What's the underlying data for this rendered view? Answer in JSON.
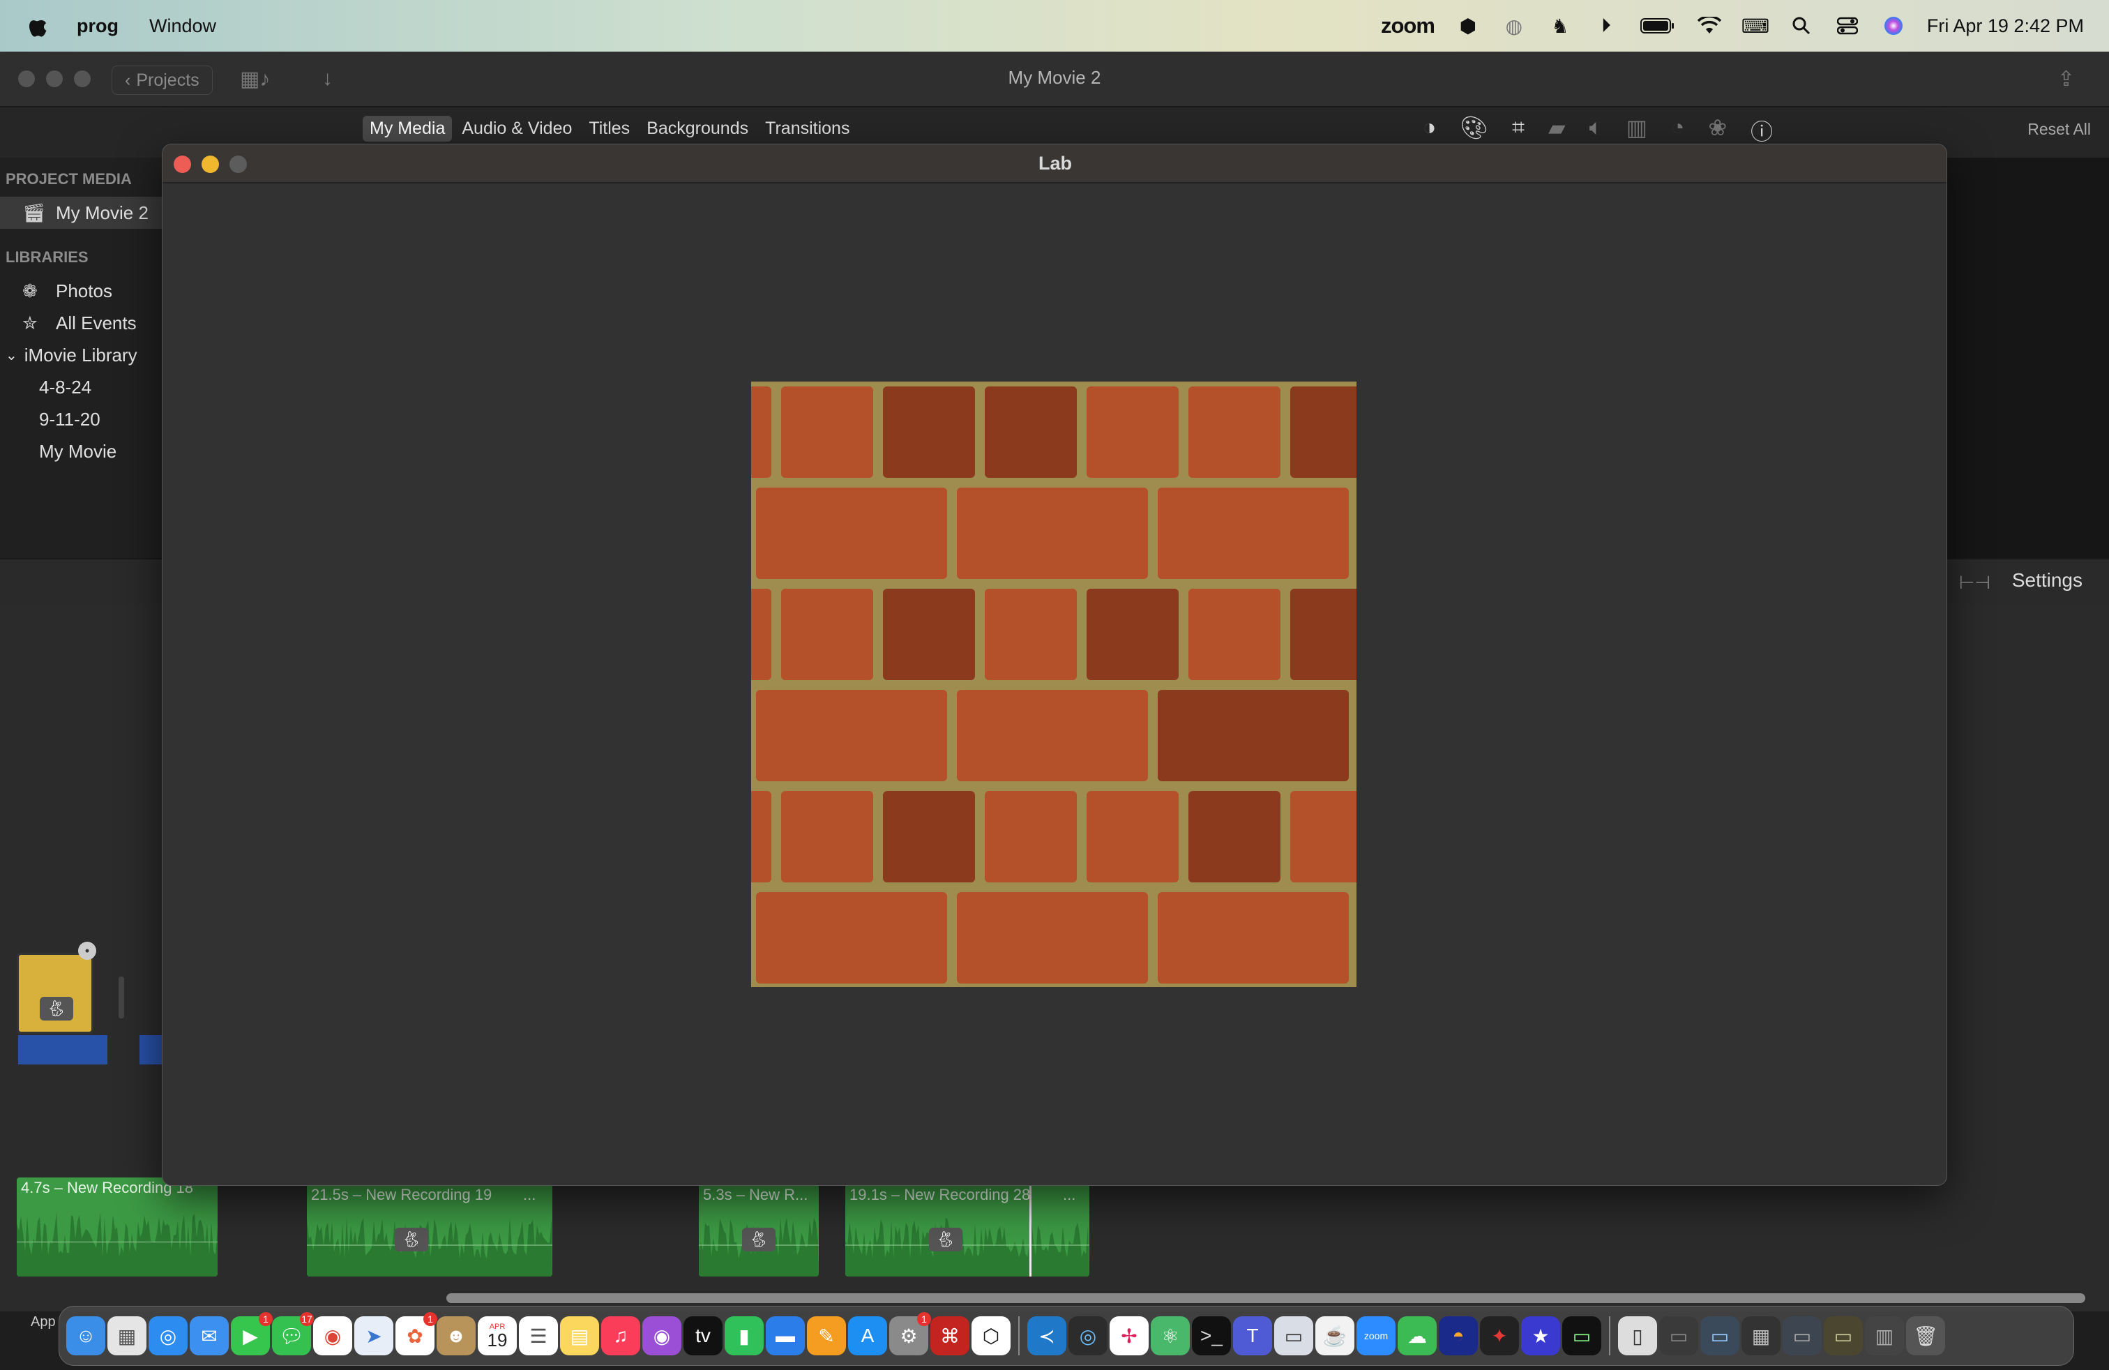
{
  "menubar": {
    "app_name": "prog",
    "menus": [
      "Window"
    ],
    "zoom_label": "zoom",
    "clock": "Fri Apr 19  2:42 PM"
  },
  "imovie": {
    "title": "My Movie 2",
    "projects_label": "Projects",
    "tabs": [
      "My Media",
      "Audio & Video",
      "Titles",
      "Backgrounds",
      "Transitions"
    ],
    "reset_all": "Reset All",
    "settings": "Settings",
    "sidebar": {
      "project_media_header": "PROJECT MEDIA",
      "project_item": "My Movie 2",
      "libraries_header": "LIBRARIES",
      "items": [
        {
          "label": "Photos",
          "icon": "photos-icon"
        },
        {
          "label": "All Events",
          "icon": "star-icon"
        },
        {
          "label": "iMovie Library",
          "icon": "chevron-down-icon"
        },
        {
          "label": "4-8-24"
        },
        {
          "label": "9-11-20"
        },
        {
          "label": "My Movie"
        }
      ]
    },
    "audio_clips": [
      {
        "label": "4.7s – New Recording 18"
      },
      {
        "label": "21.5s – New Recording 19"
      },
      {
        "label": "5.3s – New R..."
      },
      {
        "label": "19.1s – New Recording 28"
      }
    ],
    "clip_ellipsis": "..."
  },
  "lab_window": {
    "title": "Lab",
    "colors": {
      "mortar": "#9e8d4e",
      "brick": "#b5512a",
      "brick_dark": "#8c3a1e"
    }
  },
  "dock": {
    "app_label": "App",
    "calendar_month": "APR",
    "calendar_day": "19",
    "badges": {
      "facetime": "1",
      "messages": "17",
      "photos": "1",
      "settings": "1"
    }
  }
}
